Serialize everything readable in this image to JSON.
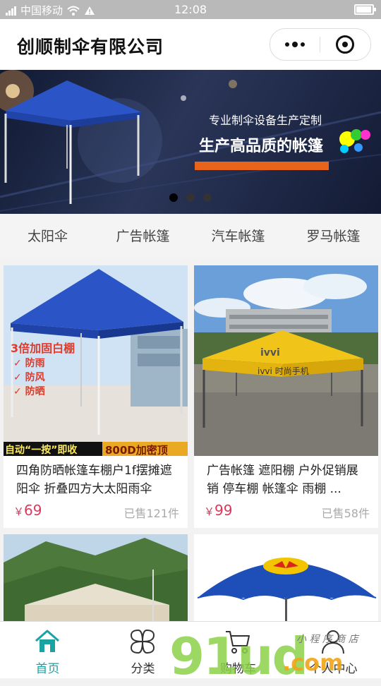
{
  "status_bar": {
    "carrier": "中国移动",
    "time": "12:08"
  },
  "header": {
    "title": "创顺制伞有限公司"
  },
  "banner": {
    "subtitle": "专业制伞设备生产定制",
    "title": "生产高品质的帐篷",
    "slide_count": 3,
    "active_slide": 0
  },
  "categories": [
    "太阳伞",
    "广告帐篷",
    "汽车帐篷",
    "罗马帐篷"
  ],
  "products": [
    {
      "name": "四角防晒帐篷车棚户1f摆摊遮阳伞 折叠四方大太阳雨伞",
      "currency": "￥",
      "price": "69",
      "sold": "已售121件",
      "image_text": [
        "3倍加固白棚",
        "防雨",
        "防风",
        "防晒",
        "自动“一按”即收",
        "800D加密顶"
      ]
    },
    {
      "name": "广告帐篷 遮阳棚 户外促销展销 停车棚 帐篷伞 雨棚 ...",
      "currency": "￥",
      "price": "99",
      "sold": "已售58件",
      "image_text": [
        "ivvi",
        "时尚手机"
      ]
    },
    {
      "name": "",
      "currency": "",
      "price": "",
      "sold": "",
      "image_text": []
    },
    {
      "name": "",
      "currency": "",
      "price": "",
      "sold": "",
      "image_text": [
        "RedBull"
      ]
    }
  ],
  "tabbar": [
    {
      "label": "首页",
      "icon": "home-icon",
      "active": true
    },
    {
      "label": "分类",
      "icon": "category-icon",
      "active": false
    },
    {
      "label": "购物车",
      "icon": "cart-icon",
      "active": false
    },
    {
      "label": "个人中心",
      "icon": "user-icon",
      "active": false
    }
  ],
  "watermark": {
    "main": "91ud",
    "domain": ".com",
    "tag": "小 程 序 商 店"
  },
  "colors": {
    "price": "#e0365a",
    "active_tab": "#1aa3a3",
    "tent_blue": "#2b54c7",
    "tent_yellow": "#f0c419"
  }
}
